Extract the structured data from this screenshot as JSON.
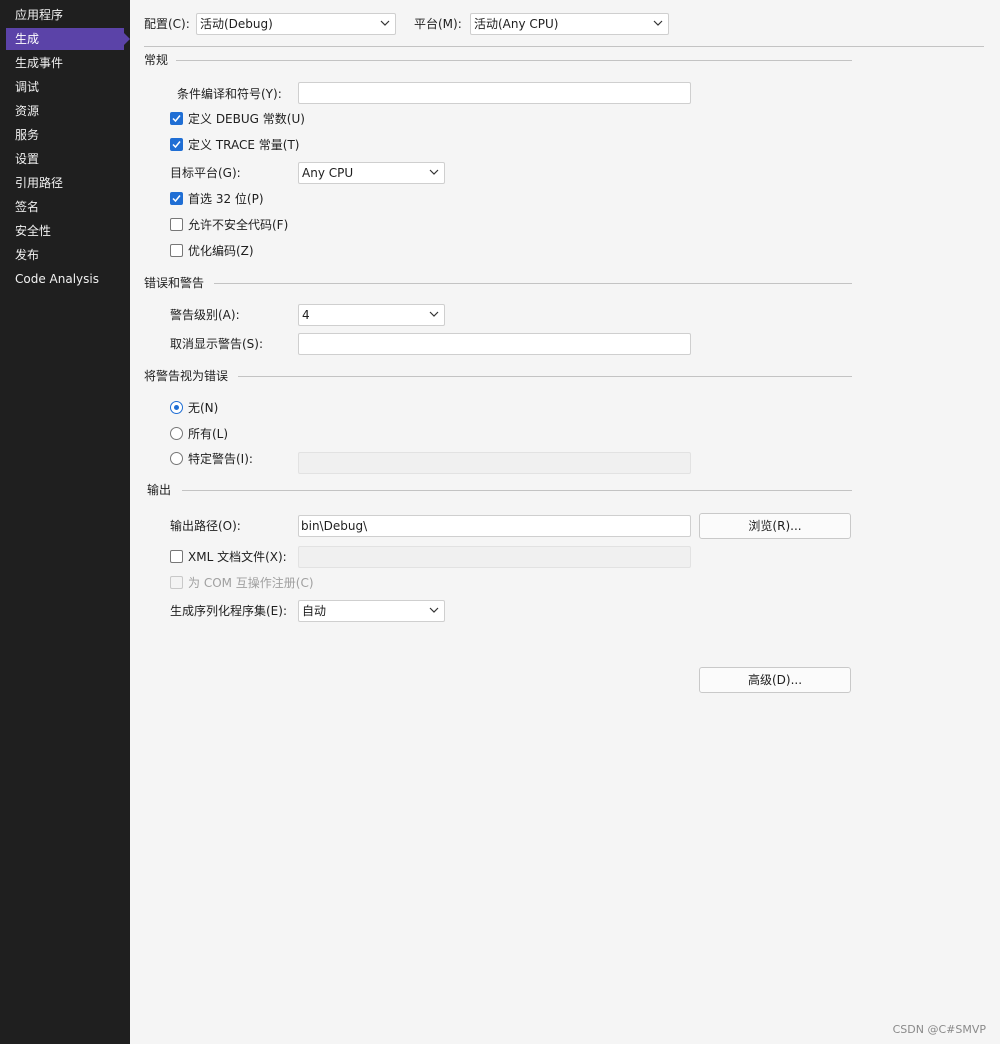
{
  "sidebar": {
    "items": [
      {
        "label": "应用程序",
        "selected": false
      },
      {
        "label": "生成",
        "selected": true
      },
      {
        "label": "生成事件",
        "selected": false
      },
      {
        "label": "调试",
        "selected": false
      },
      {
        "label": "资源",
        "selected": false
      },
      {
        "label": "服务",
        "selected": false
      },
      {
        "label": "设置",
        "selected": false
      },
      {
        "label": "引用路径",
        "selected": false
      },
      {
        "label": "签名",
        "selected": false
      },
      {
        "label": "安全性",
        "selected": false
      },
      {
        "label": "发布",
        "selected": false
      },
      {
        "label": "Code Analysis",
        "selected": false
      }
    ]
  },
  "toolbar": {
    "config_label": "配置(C):",
    "config_value": "活动(Debug)",
    "platform_label": "平台(M):",
    "platform_value": "活动(Any CPU)"
  },
  "general": {
    "title": "常规",
    "conditional_symbols_label": "条件编译和符号(Y):",
    "conditional_symbols_value": "",
    "define_debug": {
      "label": "定义 DEBUG 常数(U)",
      "checked": true
    },
    "define_trace": {
      "label": "定义 TRACE 常量(T)",
      "checked": true
    },
    "target_platform_label": "目标平台(G):",
    "target_platform_value": "Any CPU",
    "prefer_32bit": {
      "label": "首选 32 位(P)",
      "checked": true
    },
    "allow_unsafe": {
      "label": "允许不安全代码(F)",
      "checked": false
    },
    "optimize": {
      "label": "优化编码(Z)",
      "checked": false
    }
  },
  "errors": {
    "title": "错误和警告",
    "warning_level_label": "警告级别(A):",
    "warning_level_value": "4",
    "suppress_label": "取消显示警告(S):",
    "suppress_value": ""
  },
  "treat_warnings": {
    "title": "将警告视为错误",
    "none": {
      "label": "无(N)",
      "selected": true
    },
    "all": {
      "label": "所有(L)",
      "selected": false
    },
    "specific": {
      "label": "特定警告(I):",
      "selected": false
    },
    "specific_value": ""
  },
  "output": {
    "title": "输出",
    "path_label": "输出路径(O):",
    "path_value": "bin\\Debug\\",
    "browse_label": "浏览(R)...",
    "xml_doc": {
      "label": "XML 文档文件(X):",
      "checked": false
    },
    "xml_doc_value": "",
    "com_register": {
      "label": "为 COM 互操作注册(C)",
      "checked": false,
      "enabled": false
    },
    "serialization_label": "生成序列化程序集(E):",
    "serialization_value": "自动",
    "advanced_label": "高级(D)..."
  },
  "watermark": "CSDN @C#SMVP",
  "colors": {
    "sidebar_bg": "#1f1f1f",
    "selection": "#5b43a8",
    "accent": "#1f6ed4",
    "content_bg": "#f5f5f5"
  }
}
